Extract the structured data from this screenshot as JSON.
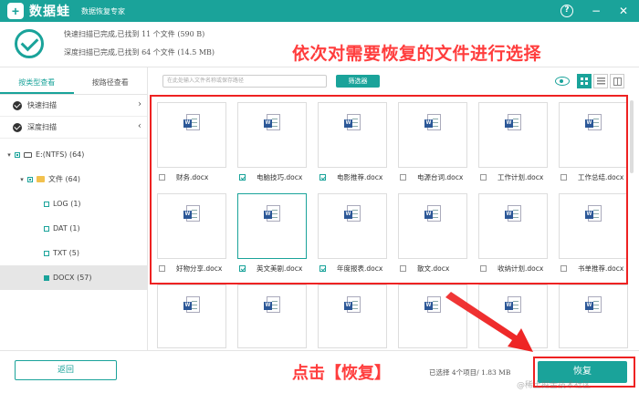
{
  "app": {
    "name": "数据蛙",
    "subtitle": "数据恢复专家",
    "logo_glyph": "+",
    "accent_color": "#1aa39a",
    "window_controls": [
      "?",
      "−",
      "✕"
    ]
  },
  "status": {
    "quick_scan": "快速扫描已完成,已找到 11 个文件 (590 B)",
    "deep_scan": "深度扫描已完成,已找到 64 个文件 (14.5 MB)"
  },
  "annotations": {
    "top": "依次对需要恢复的文件进行选择",
    "bottom": "点击【恢复】",
    "color": "#ff3d3d"
  },
  "sidebar": {
    "tabs": [
      "按类型查看",
      "按路径查看"
    ],
    "active_tab": 0,
    "scan_modes": [
      {
        "label": "快速扫描",
        "arrow": "›"
      },
      {
        "label": "深度扫描",
        "arrow": "‹"
      }
    ],
    "tree": [
      {
        "caret": "▾",
        "label": "E:(NTFS) (64)"
      },
      {
        "caret": "▾",
        "label": "文件 (64)"
      },
      {
        "caret": "",
        "label": "LOG (1)"
      },
      {
        "caret": "",
        "label": "DAT (1)"
      },
      {
        "caret": "",
        "label": "TXT (5)"
      },
      {
        "caret": "",
        "label": "DOCX (57)"
      }
    ]
  },
  "toolbar": {
    "search_placeholder": "在此处输入文件名称或保存路径",
    "filter_label": "筛选器",
    "view_icons": [
      "grid-view-icon",
      "list-view-icon",
      "column-view-icon"
    ]
  },
  "files": [
    {
      "name": "财务.docx",
      "checked": false
    },
    {
      "name": "电脑技巧.docx",
      "checked": true
    },
    {
      "name": "电影推荐.docx",
      "checked": true
    },
    {
      "name": "电源台词.docx",
      "checked": false
    },
    {
      "name": "工作计划.docx",
      "checked": false
    },
    {
      "name": "工作总结.docx",
      "checked": false
    },
    {
      "name": "好物分享.docx",
      "checked": false
    },
    {
      "name": "英文美剧.docx",
      "checked": true
    },
    {
      "name": "年度报表.docx",
      "checked": true
    },
    {
      "name": "散文.docx",
      "checked": false
    },
    {
      "name": "收纳计划.docx",
      "checked": false
    },
    {
      "name": "书单推荐.docx",
      "checked": false
    }
  ],
  "doc_icon_letter": "W",
  "bottom": {
    "back_label": "返回",
    "selection_info": "已选择 4个项目/ 1.83 MB",
    "recover_label": "恢复",
    "watermark": "@稀土掘金技术社区"
  }
}
